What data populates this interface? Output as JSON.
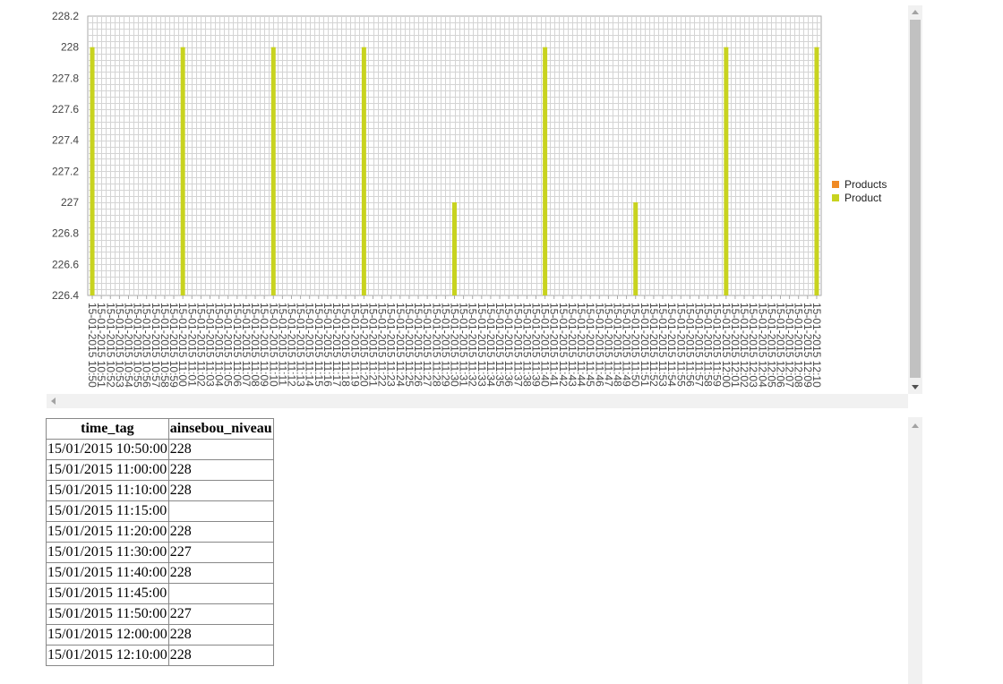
{
  "chart_data": {
    "type": "bar",
    "categories": [
      "15-01-2015 10:50",
      "15-01-2015 10:51",
      "15-01-2015 10:52",
      "15-01-2015 10:53",
      "15-01-2015 10:54",
      "15-01-2015 10:55",
      "15-01-2015 10:56",
      "15-01-2015 10:57",
      "15-01-2015 10:58",
      "15-01-2015 10:59",
      "15-01-2015 11:00",
      "15-01-2015 11:01",
      "15-01-2015 11:02",
      "15-01-2015 11:03",
      "15-01-2015 11:04",
      "15-01-2015 11:05",
      "15-01-2015 11:06",
      "15-01-2015 11:07",
      "15-01-2015 11:08",
      "15-01-2015 11:09",
      "15-01-2015 11:10",
      "15-01-2015 11:11",
      "15-01-2015 11:12",
      "15-01-2015 11:13",
      "15-01-2015 11:14",
      "15-01-2015 11:15",
      "15-01-2015 11:16",
      "15-01-2015 11:17",
      "15-01-2015 11:18",
      "15-01-2015 11:19",
      "15-01-2015 11:20",
      "15-01-2015 11:21",
      "15-01-2015 11:22",
      "15-01-2015 11:23",
      "15-01-2015 11:24",
      "15-01-2015 11:25",
      "15-01-2015 11:26",
      "15-01-2015 11:27",
      "15-01-2015 11:28",
      "15-01-2015 11:29",
      "15-01-2015 11:30",
      "15-01-2015 11:31",
      "15-01-2015 11:32",
      "15-01-2015 11:33",
      "15-01-2015 11:34",
      "15-01-2015 11:35",
      "15-01-2015 11:36",
      "15-01-2015 11:37",
      "15-01-2015 11:38",
      "15-01-2015 11:39",
      "15-01-2015 11:40",
      "15-01-2015 11:41",
      "15-01-2015 11:42",
      "15-01-2015 11:43",
      "15-01-2015 11:44",
      "15-01-2015 11:45",
      "15-01-2015 11:46",
      "15-01-2015 11:47",
      "15-01-2015 11:48",
      "15-01-2015 11:49",
      "15-01-2015 11:50",
      "15-01-2015 11:51",
      "15-01-2015 11:52",
      "15-01-2015 11:53",
      "15-01-2015 11:54",
      "15-01-2015 11:55",
      "15-01-2015 11:56",
      "15-01-2015 11:57",
      "15-01-2015 11:58",
      "15-01-2015 11:59",
      "15-01-2015 12:00",
      "15-01-2015 12:01",
      "15-01-2015 12:02",
      "15-01-2015 12:03",
      "15-01-2015 12:04",
      "15-01-2015 12:05",
      "15-01-2015 12:06",
      "15-01-2015 12:07",
      "15-01-2015 12:08",
      "15-01-2015 12:09",
      "15-01-2015 12:10"
    ],
    "series": [
      {
        "name": "Products",
        "color": "#f08a24",
        "values": [
          null,
          null,
          null,
          null,
          null,
          null,
          null,
          null,
          null,
          null,
          null,
          null,
          null,
          null,
          null,
          null,
          null,
          null,
          null,
          null,
          null,
          null,
          null,
          null,
          null,
          null,
          null,
          null,
          null,
          null,
          null,
          null,
          null,
          null,
          null,
          null,
          null,
          null,
          null,
          null,
          null,
          null,
          null,
          null,
          null,
          null,
          null,
          null,
          null,
          null,
          null,
          null,
          null,
          null,
          null,
          null,
          null,
          null,
          null,
          null,
          null,
          null,
          null,
          null,
          null,
          null,
          null,
          null,
          null,
          null,
          null,
          null,
          null,
          null,
          null,
          null,
          null,
          null,
          null,
          null,
          null
        ]
      },
      {
        "name": "Product",
        "color": "#c8d31f",
        "values": [
          228,
          null,
          null,
          null,
          null,
          null,
          null,
          null,
          null,
          null,
          228,
          null,
          null,
          null,
          null,
          null,
          null,
          null,
          null,
          null,
          228,
          null,
          null,
          null,
          null,
          null,
          null,
          null,
          null,
          null,
          228,
          null,
          null,
          null,
          null,
          null,
          null,
          null,
          null,
          null,
          227,
          null,
          null,
          null,
          null,
          null,
          null,
          null,
          null,
          null,
          228,
          null,
          null,
          null,
          null,
          null,
          null,
          null,
          null,
          null,
          227,
          null,
          null,
          null,
          null,
          null,
          null,
          null,
          null,
          null,
          228,
          null,
          null,
          null,
          null,
          null,
          null,
          null,
          null,
          null,
          228
        ]
      }
    ],
    "yticks": [
      226.4,
      226.6,
      226.8,
      227,
      227.2,
      227.4,
      227.6,
      227.8,
      228,
      228.2
    ],
    "ylim": [
      226.4,
      228.2
    ],
    "grid": true,
    "legend_position": "right",
    "title": "",
    "xlabel": "",
    "ylabel": ""
  },
  "table": {
    "headers": [
      "time_tag",
      "ainsebou_niveau"
    ],
    "rows": [
      [
        "15/01/2015 10:50:00",
        "228"
      ],
      [
        "15/01/2015 11:00:00",
        "228"
      ],
      [
        "15/01/2015 11:10:00",
        "228"
      ],
      [
        "15/01/2015 11:15:00",
        ""
      ],
      [
        "15/01/2015 11:20:00",
        "228"
      ],
      [
        "15/01/2015 11:30:00",
        "227"
      ],
      [
        "15/01/2015 11:40:00",
        "228"
      ],
      [
        "15/01/2015 11:45:00",
        ""
      ],
      [
        "15/01/2015 11:50:00",
        "227"
      ],
      [
        "15/01/2015 12:00:00",
        "228"
      ],
      [
        "15/01/2015 12:10:00",
        "228"
      ]
    ]
  },
  "colors": {
    "grid_line": "#d4d4d4",
    "axis_line": "#aaaaaa",
    "scrollbar_track": "#f1f1f1",
    "scrollbar_thumb": "#c1c1c1"
  }
}
